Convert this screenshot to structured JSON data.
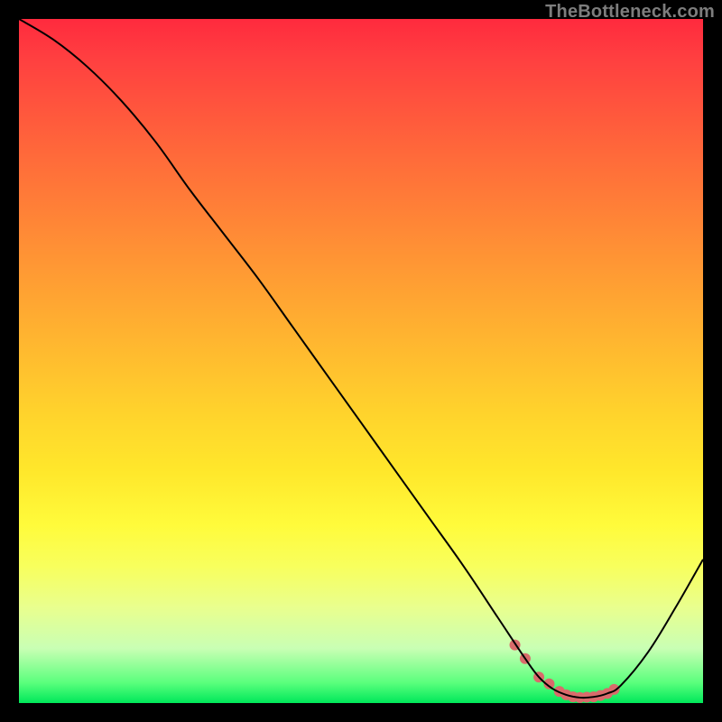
{
  "watermark": "TheBottleneck.com",
  "chart_data": {
    "type": "line",
    "title": "",
    "xlabel": "",
    "ylabel": "",
    "xlim": [
      0,
      100
    ],
    "ylim": [
      0,
      100
    ],
    "series": [
      {
        "name": "bottleneck-curve",
        "x": [
          0,
          5,
          10,
          15,
          20,
          25,
          30,
          35,
          40,
          45,
          50,
          55,
          60,
          65,
          70,
          74,
          76,
          78,
          80,
          82,
          84,
          86,
          88,
          92,
          96,
          100
        ],
        "values": [
          100,
          97,
          93,
          88,
          82,
          75,
          68.5,
          62,
          55,
          48,
          41,
          34,
          27,
          20,
          12.5,
          6.5,
          3.8,
          2.1,
          1.2,
          0.8,
          0.9,
          1.4,
          2.6,
          7.5,
          14,
          21
        ]
      }
    ],
    "markers": {
      "name": "optimal-range-dots",
      "x": [
        72.5,
        74,
        76,
        77.5,
        79,
        80,
        81,
        82,
        83,
        84,
        85,
        86,
        87
      ],
      "values": [
        8.5,
        6.5,
        3.8,
        2.8,
        1.7,
        1.2,
        0.9,
        0.8,
        0.85,
        0.9,
        1.1,
        1.4,
        2.0
      ],
      "color": "#d96b6b",
      "radius": 6
    },
    "curve_stroke": "#000000",
    "curve_width": 2
  }
}
